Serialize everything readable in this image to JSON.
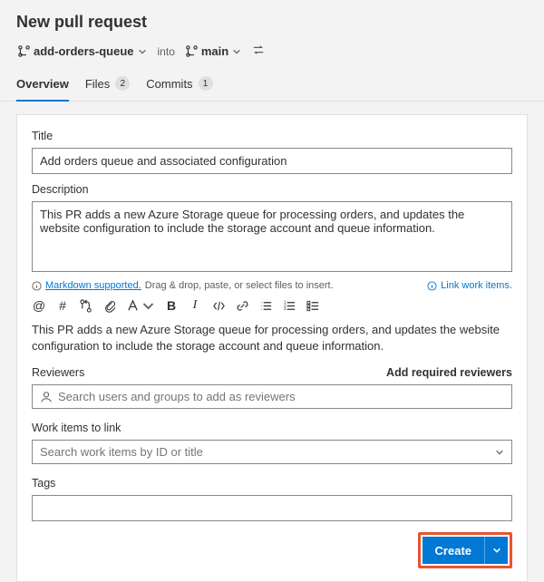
{
  "page": {
    "title": "New pull request"
  },
  "branches": {
    "source": "add-orders-queue",
    "into": "into",
    "target": "main"
  },
  "tabs": {
    "overview": "Overview",
    "files": {
      "label": "Files",
      "count": "2"
    },
    "commits": {
      "label": "Commits",
      "count": "1"
    }
  },
  "fields": {
    "title_label": "Title",
    "title_value": "Add orders queue and associated configuration",
    "description_label": "Description",
    "description_value": "This PR adds a new Azure Storage queue for processing orders, and updates the website configuration to include the storage account and queue information.",
    "hint_markdown": "Markdown supported.",
    "hint_drag": "Drag & drop, paste, or select files to insert.",
    "link_work_items": "Link work items.",
    "preview": "This PR adds a new Azure Storage queue for processing orders, and updates the website configuration to include the storage account and queue information.",
    "reviewers_label": "Reviewers",
    "add_required": "Add required reviewers",
    "reviewers_placeholder": "Search users and groups to add as reviewers",
    "workitems_label": "Work items to link",
    "workitems_placeholder": "Search work items by ID or title",
    "tags_label": "Tags"
  },
  "buttons": {
    "create": "Create"
  }
}
